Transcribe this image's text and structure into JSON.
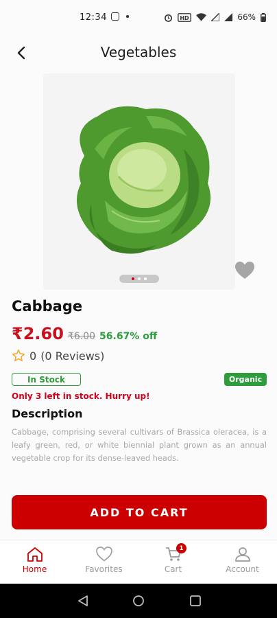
{
  "status_bar": {
    "time": "12:34",
    "battery": "66%"
  },
  "header": {
    "title": "Vegetables"
  },
  "product": {
    "name": "Cabbage",
    "price": "₹2.60",
    "mrp": "₹6.00",
    "discount": "56.67% off",
    "rating": "0",
    "reviews": "(0 Reviews)",
    "stock_status": "In Stock",
    "tag": "Organic",
    "stock_warning": "Only 3 left in stock. Hurry up!",
    "description_heading": "Description",
    "description": "Cabbage, comprising several cultivars of Brassica oleracea, is a leafy green, red, or white biennial plant grown as an annual vegetable crop for its dense-leaved heads.",
    "carousel_total": 3,
    "carousel_active_index": 0
  },
  "cta": {
    "add_to_cart": "ADD TO CART"
  },
  "bottom_nav": {
    "items": [
      {
        "label": "Home",
        "icon": "home-icon",
        "active": true
      },
      {
        "label": "Favorites",
        "icon": "heart-icon",
        "active": false
      },
      {
        "label": "Cart",
        "icon": "cart-icon",
        "active": false,
        "badge": "1"
      },
      {
        "label": "Account",
        "icon": "user-icon",
        "active": false
      }
    ]
  },
  "colors": {
    "accent": "#cc0000",
    "price": "#c8101e",
    "green": "#2e9d3b"
  }
}
